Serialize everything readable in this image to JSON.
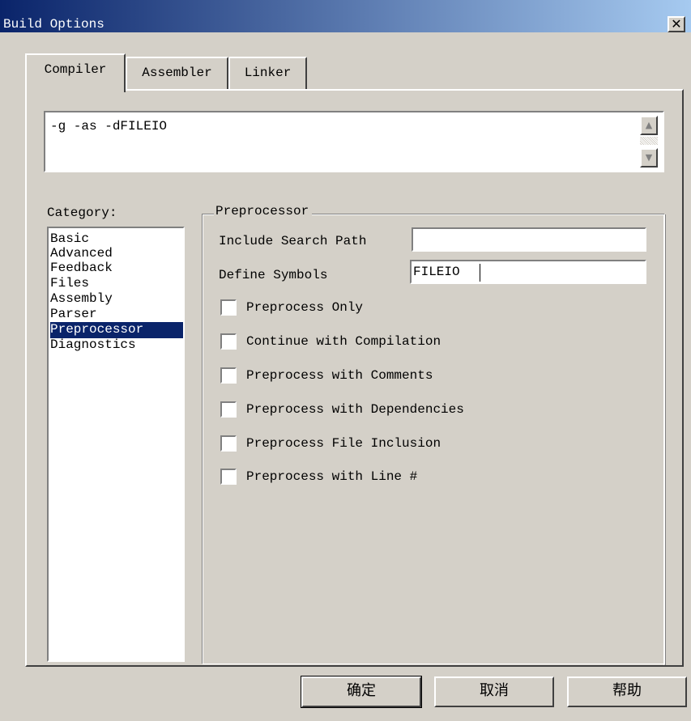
{
  "window": {
    "title": "Build Options",
    "close_glyph": "✕"
  },
  "tabs": [
    {
      "label": "Compiler",
      "active": true
    },
    {
      "label": "Assembler",
      "active": false
    },
    {
      "label": "Linker",
      "active": false
    }
  ],
  "options": {
    "value": "-g -as -dFILEIO",
    "scroll_up_icon": "scroll-up-arrow-icon",
    "scroll_down_icon": "scroll-down-arrow-icon"
  },
  "category": {
    "label": "Category:",
    "items": [
      "Basic",
      "Advanced",
      "Feedback",
      "Files",
      "Assembly",
      "Parser",
      "Preprocessor",
      "Diagnostics"
    ],
    "selected": "Preprocessor"
  },
  "preprocessor": {
    "title": "Preprocessor",
    "include_search_path": {
      "label": "Include Search Path",
      "value": ""
    },
    "define_symbols": {
      "label": "Define Symbols",
      "value": "FILEIO"
    },
    "checkboxes": [
      {
        "label": "Preprocess Only",
        "checked": false
      },
      {
        "label": "Continue with Compilation",
        "checked": false
      },
      {
        "label": "Preprocess with Comments",
        "checked": false
      },
      {
        "label": "Preprocess with Dependencies",
        "checked": false
      },
      {
        "label": "Preprocess File Inclusion",
        "checked": false
      },
      {
        "label": "Preprocess with Line #",
        "checked": false
      }
    ]
  },
  "buttons": {
    "ok": "确定",
    "cancel": "取消",
    "help": "帮助"
  },
  "colors": {
    "face": "#d4d0c8",
    "title_start": "#0a246a",
    "title_end": "#a6caf0",
    "selection": "#0a246a"
  }
}
